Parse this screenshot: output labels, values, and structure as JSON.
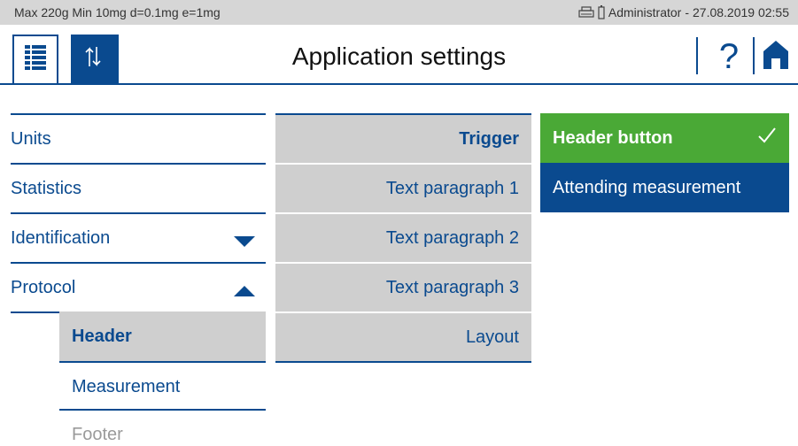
{
  "status": {
    "capacity": "Max 220g  Min 10mg  d=0.1mg  e=1mg",
    "user": "Administrator",
    "separator": "-",
    "datetime": "27.08.2019 02:55",
    "icons": [
      "printer-icon",
      "battery-icon"
    ]
  },
  "header": {
    "title": "Application settings",
    "help_label": "?",
    "tabs": [
      {
        "icon": "list-icon",
        "active": true
      },
      {
        "icon": "up-down-arrows-icon",
        "active": false
      }
    ],
    "home_icon": "home-icon"
  },
  "menu": {
    "items": [
      {
        "label": "Units",
        "arrow": null
      },
      {
        "label": "Statistics",
        "arrow": null
      },
      {
        "label": "Identification",
        "arrow": "down"
      },
      {
        "label": "Protocol",
        "arrow": "up"
      }
    ],
    "subitems": [
      {
        "label": "Header",
        "active": true
      },
      {
        "label": "Measurement",
        "active": false
      },
      {
        "label": "Footer",
        "active": false
      }
    ]
  },
  "submenu": {
    "items": [
      {
        "label": "Trigger",
        "active": true
      },
      {
        "label": "Text paragraph 1",
        "active": false
      },
      {
        "label": "Text paragraph 2",
        "active": false
      },
      {
        "label": "Text paragraph 3",
        "active": false
      },
      {
        "label": "Layout",
        "active": false
      }
    ]
  },
  "options": {
    "items": [
      {
        "label": "Header button",
        "selected": true
      },
      {
        "label": "Attending measurement",
        "selected": false
      }
    ]
  },
  "colors": {
    "primary": "#0a4a8f",
    "selected": "#4aa936",
    "panel": "#cfcfcf",
    "statusbar": "#d6d6d6",
    "disabled": "#9a9a9a"
  }
}
